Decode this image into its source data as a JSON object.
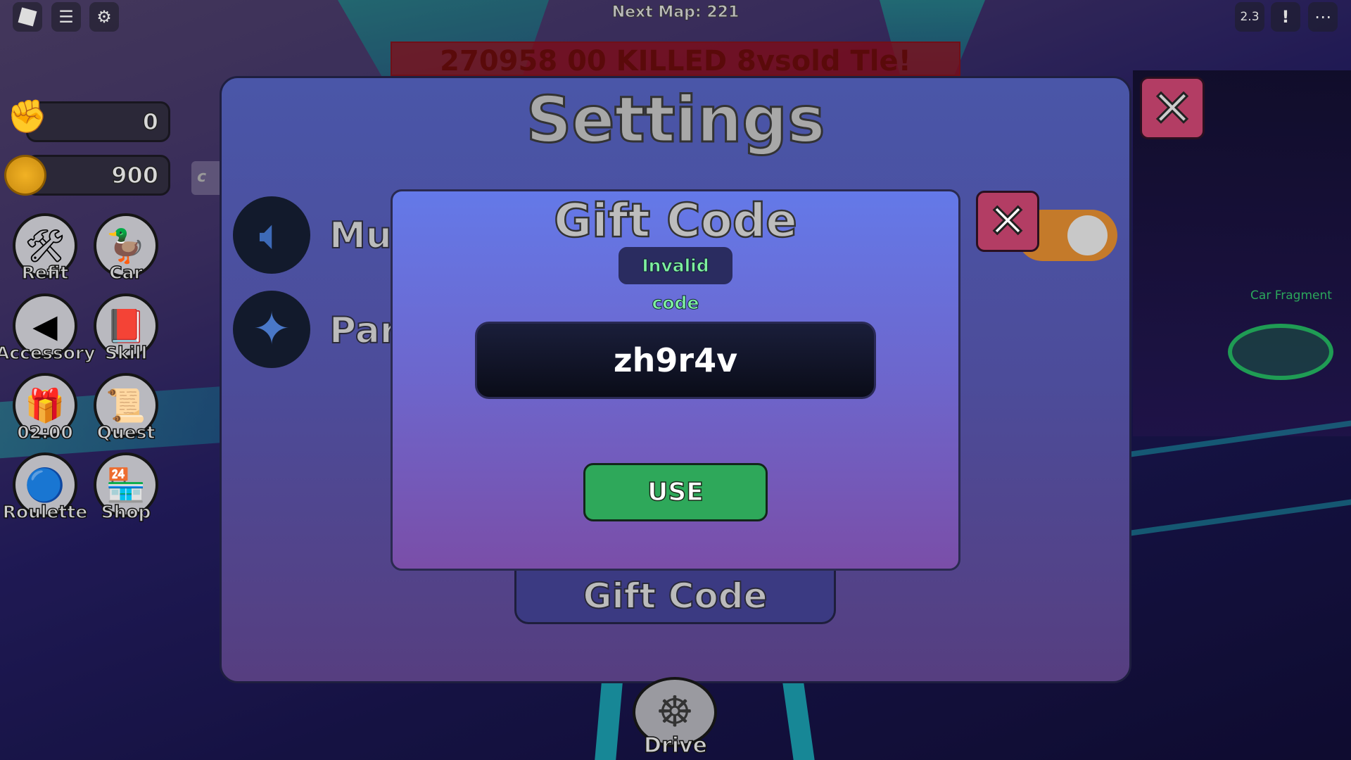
{
  "hud": {
    "next_map": "Next Map: 221",
    "banner": "270958  00 KILLED 8vsold  Tle!",
    "version": "2.3",
    "car_fragment": "Car Fragment",
    "top_left_icons": [
      "roblox-icon",
      "chat-icon",
      "gear-icon"
    ],
    "top_right_icons": [
      "report-icon",
      "more-icon"
    ]
  },
  "stats": {
    "power": "0",
    "coins": "900",
    "side_tab": "c"
  },
  "side_buttons": [
    {
      "label": "Refit",
      "icon": "tools-icon",
      "glyph": "🛠"
    },
    {
      "label": "Car",
      "icon": "duck-car-icon",
      "glyph": "🦆"
    },
    {
      "label": "Accessory",
      "icon": "cone-icon",
      "glyph": "◀"
    },
    {
      "label": "Skill",
      "icon": "book-icon",
      "glyph": "📕"
    },
    {
      "label": "02:00",
      "icon": "gift-icon",
      "glyph": "🎁"
    },
    {
      "label": "Quest",
      "icon": "scroll-icon",
      "glyph": "📜"
    },
    {
      "label": "Roulette",
      "icon": "roulette-icon",
      "glyph": "🔵"
    },
    {
      "label": "Shop",
      "icon": "shop-icon",
      "glyph": "🏪"
    }
  ],
  "settings": {
    "title": "Settings",
    "rows": [
      {
        "label": "Mus",
        "icon": "speaker-icon"
      },
      {
        "label": "Part",
        "icon": "sparkle-icon"
      }
    ],
    "toggle_on": true,
    "toggle_color": "#c47a2a",
    "gift_code_button": "Gift Code"
  },
  "gift_modal": {
    "title": "Gift Code",
    "status": "Invalid code",
    "status_color": "#7ef0a0",
    "code_value": "zh9r4v",
    "use_label": "USE",
    "use_color": "#2ea85a"
  },
  "drive": {
    "label": "Drive"
  }
}
